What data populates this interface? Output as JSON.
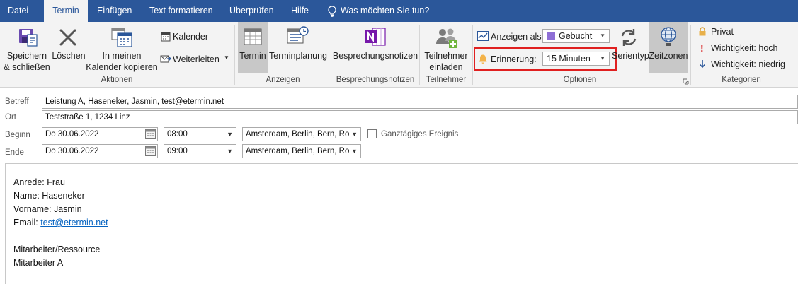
{
  "tabs": [
    {
      "label": "Datei",
      "active": false
    },
    {
      "label": "Termin",
      "active": true
    },
    {
      "label": "Einfügen",
      "active": false
    },
    {
      "label": "Text formatieren",
      "active": false
    },
    {
      "label": "Überprüfen",
      "active": false
    },
    {
      "label": "Hilfe",
      "active": false
    }
  ],
  "tell_me": "Was möchten Sie tun?",
  "ribbon": {
    "actions": {
      "save_line1": "Speichern",
      "save_line2": "& schließen",
      "delete": "Löschen",
      "copy_line1": "In meinen",
      "copy_line2": "Kalender kopieren",
      "calendar": "Kalender",
      "forward": "Weiterleiten",
      "group": "Aktionen"
    },
    "show": {
      "appointment": "Termin",
      "scheduling": "Terminplanung",
      "group": "Anzeigen"
    },
    "meeting_notes": {
      "label": "Besprechungsnotizen",
      "group": "Besprechungsnotizen"
    },
    "attendees": {
      "line1": "Teilnehmer",
      "line2": "einladen",
      "group": "Teilnehmer"
    },
    "options": {
      "show_as_label": "Anzeigen als:",
      "show_as_value": "Gebucht",
      "reminder_label": "Erinnerung:",
      "reminder_value": "15 Minuten",
      "recurrence": "Serientyp",
      "timezones": "Zeitzonen",
      "group": "Optionen"
    },
    "tags": {
      "private": "Privat",
      "high": "Wichtigkeit: hoch",
      "low": "Wichtigkeit: niedrig",
      "group": "Kategorien"
    }
  },
  "form": {
    "subject_label": "Betreff",
    "subject_value": "Leistung A, Haseneker, Jasmin, test@etermin.net",
    "location_label": "Ort",
    "location_value": "Teststraße 1, 1234 Linz",
    "start_label": "Beginn",
    "start_date": "Do 30.06.2022",
    "start_time": "08:00",
    "start_tz": "Amsterdam, Berlin, Bern, Ro",
    "all_day": "Ganztägiges Ereignis",
    "end_label": "Ende",
    "end_date": "Do 30.06.2022",
    "end_time": "09:00",
    "end_tz": "Amsterdam, Berlin, Bern, Ro"
  },
  "body": {
    "line1": "Anrede: Frau",
    "line2": "Name: Haseneker",
    "line3": "Vorname: Jasmin",
    "email_label": "Email: ",
    "email_link": "test@etermin.net",
    "line5": "Mitarbeiter/Ressource",
    "line6": "Mitarbeiter A"
  },
  "colors": {
    "brand": "#2b579a",
    "highlight": "#e02020",
    "onenote": "#7719aa"
  }
}
